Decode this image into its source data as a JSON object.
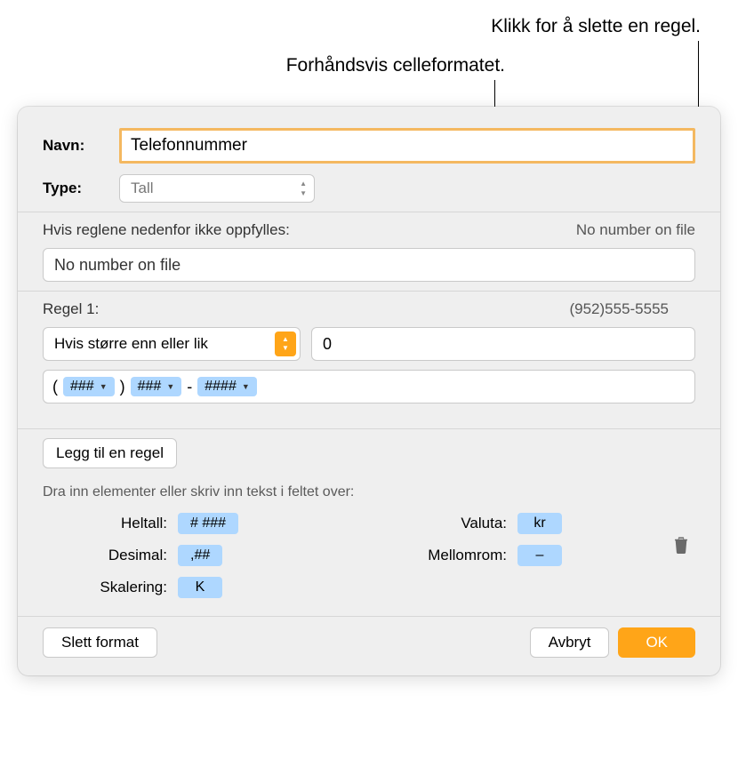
{
  "callouts": {
    "delete_rule": "Klikk for å slette en regel.",
    "preview_format": "Forhåndsvis celleformatet."
  },
  "labels": {
    "name": "Navn:",
    "type": "Type:",
    "fallback": "Hvis reglene nedenfor ikke oppfylles:",
    "rule_n": "Regel 1:",
    "add_rule": "Legg til en regel",
    "hint": "Dra inn elementer eller skriv inn tekst i feltet over:",
    "integer": "Heltall:",
    "decimal": "Desimal:",
    "scale": "Skalering:",
    "currency": "Valuta:",
    "space": "Mellomrom:",
    "delete_format": "Slett format",
    "cancel": "Avbryt",
    "ok": "OK"
  },
  "values": {
    "name": "Telefonnummer",
    "type": "Tall",
    "fallback_preview": "No number on file",
    "fallback_value": "No number on file",
    "rule_preview": "(952)555-5555",
    "condition": "Hvis større enn eller lik",
    "condition_value": "0"
  },
  "format_tokens": {
    "open": "(",
    "t1": "###",
    "close": ")",
    "t2": "###",
    "dash": "-",
    "t3": "####"
  },
  "elements": {
    "integer": "# ###",
    "decimal": ",##",
    "scale": "K",
    "currency": "kr",
    "space": "–"
  }
}
